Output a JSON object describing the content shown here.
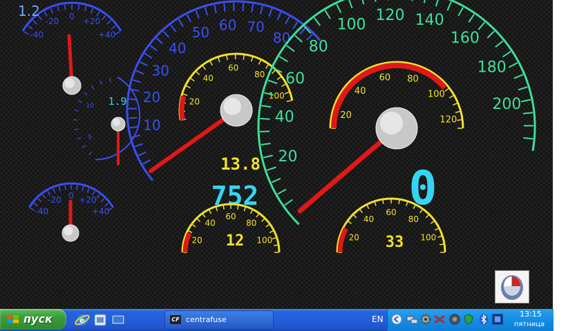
{
  "dashboard": {
    "mode_label": "1.2",
    "colors": {
      "blue": "#3b4ff2",
      "green": "#3fe09a",
      "yellow": "#f1e22a",
      "cyan": "#34d5f2",
      "red": "#e01818"
    },
    "temp_gauge_top": {
      "labels": [
        "-40",
        "-20",
        "0",
        "+20",
        "+40"
      ],
      "value": 0
    },
    "temp_gauge_bottom": {
      "labels": [
        "-40",
        "-20",
        "0",
        "+20",
        "+40"
      ],
      "value": 0
    },
    "small_dial": {
      "labels": [
        "10",
        "5"
      ],
      "readout": "1.9"
    },
    "rpm_gauge": {
      "labels": [
        "10",
        "20",
        "30",
        "40",
        "50",
        "60",
        "70",
        "80"
      ]
    },
    "voltage_gauge": {
      "labels": [
        "20",
        "40",
        "60",
        "80",
        "100"
      ],
      "readout": "13.8"
    },
    "counter_readout": "752",
    "speed_gauge": {
      "labels": [
        "20",
        "40",
        "60",
        "80",
        "100",
        "120",
        "140",
        "160",
        "180",
        "200"
      ],
      "digital_speed": "0"
    },
    "speed_inner_gauge": {
      "labels": [
        "20",
        "40",
        "60",
        "80",
        "100",
        "120"
      ]
    },
    "bottom_left_gauge": {
      "labels": [
        "20",
        "40",
        "60",
        "80",
        "100"
      ],
      "readout": "12"
    },
    "bottom_right_gauge": {
      "labels": [
        "20",
        "40",
        "60",
        "80",
        "100"
      ],
      "readout": "33"
    }
  },
  "taskbar": {
    "start_label": "пуск",
    "task_label": "centrafuse",
    "task_icon_text": "CF",
    "quick_launch": [
      "ie-icon",
      "media-icon",
      "desktop-icon"
    ],
    "language": "EN",
    "tray_icons": [
      "back-arrow-icon",
      "network-icon",
      "gear-icon",
      "satellite-icon",
      "disc-icon",
      "shield-icon",
      "bluetooth-icon",
      "app-tray-icon"
    ],
    "clock_time": "13:15",
    "clock_day": "пятница"
  }
}
